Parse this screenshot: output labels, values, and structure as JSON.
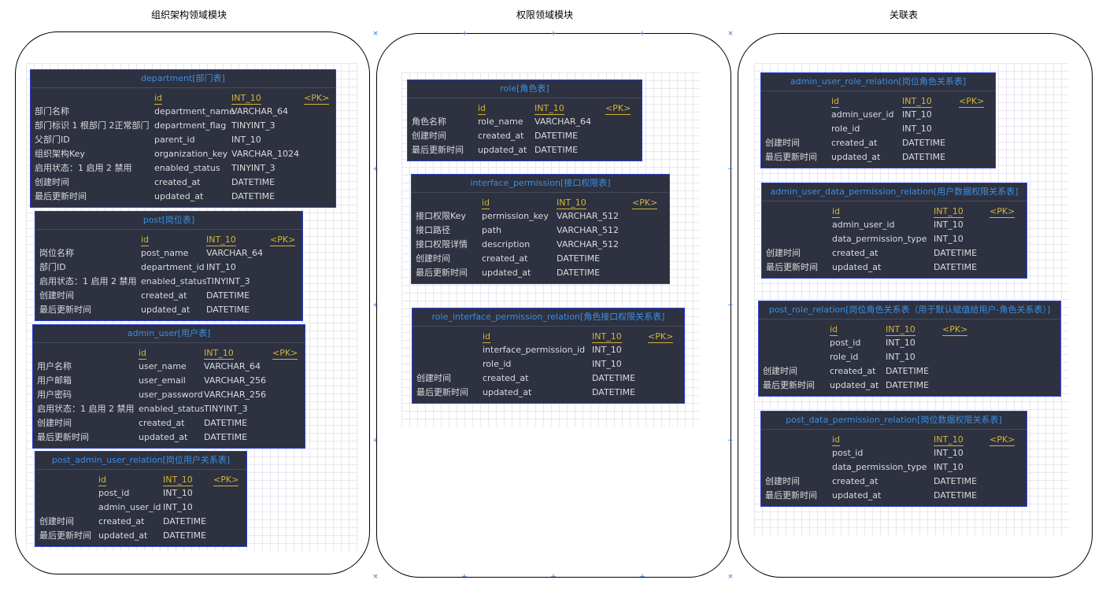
{
  "sections": [
    {
      "title": "组织架构领域模块",
      "tables": [
        {
          "title": "department[部门表]",
          "rows": [
            {
              "desc": "",
              "name": "id",
              "type": "INT_10",
              "key": "<PK>"
            },
            {
              "desc": "部门名称",
              "name": "department_name",
              "type": "VARCHAR_64",
              "key": ""
            },
            {
              "desc": "部门标识 1 根部门 2正常部门",
              "name": "department_flag",
              "type": "TINYINT_3",
              "key": ""
            },
            {
              "desc": "父部门ID",
              "name": "parent_id",
              "type": "INT_10",
              "key": ""
            },
            {
              "desc": "组织架构Key",
              "name": "organization_key",
              "type": "VARCHAR_1024",
              "key": ""
            },
            {
              "desc": "启用状态：1 启用 2 禁用",
              "name": "enabled_status",
              "type": "TINYINT_3",
              "key": ""
            },
            {
              "desc": "创建时间",
              "name": "created_at",
              "type": "DATETIME",
              "key": ""
            },
            {
              "desc": "最后更新时间",
              "name": "updated_at",
              "type": "DATETIME",
              "key": ""
            }
          ]
        },
        {
          "title": "post[岗位表]",
          "rows": [
            {
              "desc": "",
              "name": "id",
              "type": "INT_10",
              "key": "<PK>"
            },
            {
              "desc": "岗位名称",
              "name": "post_name",
              "type": "VARCHAR_64",
              "key": ""
            },
            {
              "desc": "部门ID",
              "name": "department_id",
              "type": "INT_10",
              "key": ""
            },
            {
              "desc": "启用状态：1 启用 2 禁用",
              "name": "enabled_status",
              "type": "TINYINT_3",
              "key": ""
            },
            {
              "desc": "创建时间",
              "name": "created_at",
              "type": "DATETIME",
              "key": ""
            },
            {
              "desc": "最后更新时间",
              "name": "updated_at",
              "type": "DATETIME",
              "key": ""
            }
          ]
        },
        {
          "title": "admin_user[用户表]",
          "rows": [
            {
              "desc": "",
              "name": "id",
              "type": "INT_10",
              "key": "<PK>"
            },
            {
              "desc": "用户名称",
              "name": "user_name",
              "type": "VARCHAR_64",
              "key": ""
            },
            {
              "desc": "用户邮箱",
              "name": "user_email",
              "type": "VARCHAR_256",
              "key": ""
            },
            {
              "desc": "用户密码",
              "name": "user_password",
              "type": "VARCHAR_256",
              "key": ""
            },
            {
              "desc": "启用状态：1 启用 2 禁用",
              "name": "enabled_status",
              "type": "TINYINT_3",
              "key": ""
            },
            {
              "desc": "创建时间",
              "name": "created_at",
              "type": "DATETIME",
              "key": ""
            },
            {
              "desc": "最后更新时间",
              "name": "updated_at",
              "type": "DATETIME",
              "key": ""
            }
          ]
        },
        {
          "title": "post_admin_user_relation[岗位用户关系表]",
          "rows": [
            {
              "desc": "",
              "name": "id",
              "type": "INT_10",
              "key": "<PK>"
            },
            {
              "desc": "",
              "name": "post_id",
              "type": "INT_10",
              "key": ""
            },
            {
              "desc": "",
              "name": "admin_user_id",
              "type": "INT_10",
              "key": ""
            },
            {
              "desc": "创建时间",
              "name": "created_at",
              "type": "DATETIME",
              "key": ""
            },
            {
              "desc": "最后更新时间",
              "name": "updated_at",
              "type": "DATETIME",
              "key": ""
            }
          ]
        }
      ]
    },
    {
      "title": "权限领域模块",
      "tables": [
        {
          "title": "role[角色表]",
          "rows": [
            {
              "desc": "",
              "name": "id",
              "type": "INT_10",
              "key": "<PK>"
            },
            {
              "desc": "角色名称",
              "name": "role_name",
              "type": "VARCHAR_64",
              "key": ""
            },
            {
              "desc": "创建时间",
              "name": "created_at",
              "type": "DATETIME",
              "key": ""
            },
            {
              "desc": "最后更新时间",
              "name": "updated_at",
              "type": "DATETIME",
              "key": ""
            }
          ]
        },
        {
          "title": "interface_permission[接口权限表]",
          "rows": [
            {
              "desc": "",
              "name": "id",
              "type": "INT_10",
              "key": "<PK>"
            },
            {
              "desc": "接口权限Key",
              "name": "permission_key",
              "type": "VARCHAR_512",
              "key": ""
            },
            {
              "desc": "接口路径",
              "name": "path",
              "type": "VARCHAR_512",
              "key": ""
            },
            {
              "desc": "接口权限详情",
              "name": "description",
              "type": "VARCHAR_512",
              "key": ""
            },
            {
              "desc": "创建时间",
              "name": "created_at",
              "type": "DATETIME",
              "key": ""
            },
            {
              "desc": "最后更新时间",
              "name": "updated_at",
              "type": "DATETIME",
              "key": ""
            }
          ]
        },
        {
          "title": "role_interface_permission_relation[角色接口权限关系表]",
          "rows": [
            {
              "desc": "",
              "name": "id",
              "type": "INT_10",
              "key": "<PK>"
            },
            {
              "desc": "",
              "name": "interface_permission_id",
              "type": "INT_10",
              "key": ""
            },
            {
              "desc": "",
              "name": "role_id",
              "type": "INT_10",
              "key": ""
            },
            {
              "desc": "创建时间",
              "name": "created_at",
              "type": "DATETIME",
              "key": ""
            },
            {
              "desc": "最后更新时间",
              "name": "updated_at",
              "type": "DATETIME",
              "key": ""
            }
          ]
        }
      ]
    },
    {
      "title": "关联表",
      "tables": [
        {
          "title": "admin_user_role_relation[岗位角色关系表]",
          "rows": [
            {
              "desc": "",
              "name": "id",
              "type": "INT_10",
              "key": "<PK>"
            },
            {
              "desc": "",
              "name": "admin_user_id",
              "type": "INT_10",
              "key": ""
            },
            {
              "desc": "",
              "name": "role_id",
              "type": "INT_10",
              "key": ""
            },
            {
              "desc": "创建时间",
              "name": "created_at",
              "type": "DATETIME",
              "key": ""
            },
            {
              "desc": "最后更新时间",
              "name": "updated_at",
              "type": "DATETIME",
              "key": ""
            }
          ]
        },
        {
          "title": "admin_user_data_permission_relation[用户数据权限关系表]",
          "rows": [
            {
              "desc": "",
              "name": "id",
              "type": "INT_10",
              "key": "<PK>"
            },
            {
              "desc": "",
              "name": "admin_user_id",
              "type": "INT_10",
              "key": ""
            },
            {
              "desc": "",
              "name": "data_permission_type",
              "type": "INT_10",
              "key": ""
            },
            {
              "desc": "创建时间",
              "name": "created_at",
              "type": "DATETIME",
              "key": ""
            },
            {
              "desc": "最后更新时间",
              "name": "updated_at",
              "type": "DATETIME",
              "key": ""
            }
          ]
        },
        {
          "title": "post_role_relation[岗位角色关系表（用于默认赋值给用户-角色关系表）]",
          "rows": [
            {
              "desc": "",
              "name": "id",
              "type": "INT_10",
              "key": "<PK>"
            },
            {
              "desc": "",
              "name": "post_id",
              "type": "INT_10",
              "key": ""
            },
            {
              "desc": "",
              "name": "role_id",
              "type": "INT_10",
              "key": ""
            },
            {
              "desc": "创建时间",
              "name": "created_at",
              "type": "DATETIME",
              "key": ""
            },
            {
              "desc": "最后更新时间",
              "name": "updated_at",
              "type": "DATETIME",
              "key": ""
            }
          ]
        },
        {
          "title": "post_data_permission_relation[岗位数据权限关系表]",
          "rows": [
            {
              "desc": "",
              "name": "id",
              "type": "INT_10",
              "key": "<PK>"
            },
            {
              "desc": "",
              "name": "post_id",
              "type": "INT_10",
              "key": ""
            },
            {
              "desc": "",
              "name": "data_permission_type",
              "type": "INT_10",
              "key": ""
            },
            {
              "desc": "创建时间",
              "name": "created_at",
              "type": "DATETIME",
              "key": ""
            },
            {
              "desc": "最后更新时间",
              "name": "updated_at",
              "type": "DATETIME",
              "key": ""
            }
          ]
        }
      ]
    }
  ]
}
